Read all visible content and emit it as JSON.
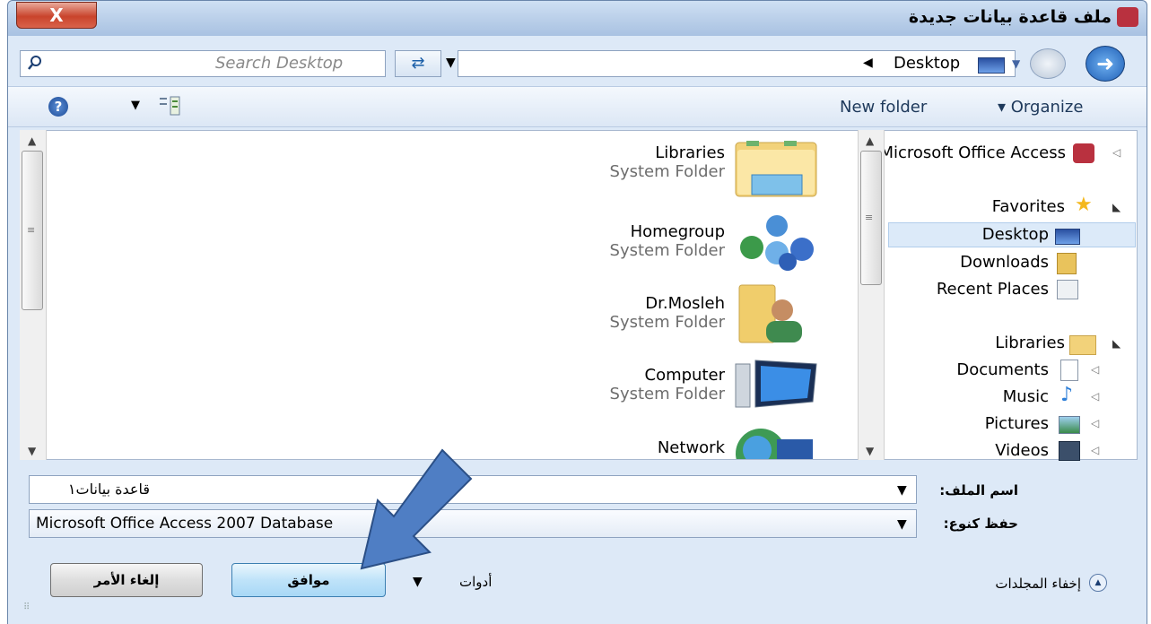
{
  "window": {
    "title": "ملف قاعدة بيانات جديدة",
    "close_label": "X"
  },
  "search": {
    "placeholder": "Search Desktop"
  },
  "address": {
    "location": "Desktop"
  },
  "toolbar": {
    "new_folder": "New folder",
    "organize": "Organize"
  },
  "files": [
    {
      "name": "Libraries",
      "type": "System Folder",
      "icon": "libraries-folder-icon"
    },
    {
      "name": "Homegroup",
      "type": "System Folder",
      "icon": "homegroup-icon"
    },
    {
      "name": "Dr.Mosleh",
      "type": "System Folder",
      "icon": "user-folder-icon"
    },
    {
      "name": "Computer",
      "type": "System Folder",
      "icon": "computer-icon"
    },
    {
      "name": "Network",
      "type": "",
      "icon": "network-icon"
    }
  ],
  "nav": {
    "top": "Microsoft Office Access",
    "favorites": "Favorites",
    "desktop": "Desktop",
    "downloads": "Downloads",
    "recent": "Recent Places",
    "libraries": "Libraries",
    "documents": "Documents",
    "music": "Music",
    "pictures": "Pictures",
    "videos": "Videos"
  },
  "form": {
    "filename_label": "اسم الملف:",
    "filename_value": "قاعدة بيانات١",
    "filetype_label": "حفظ كنوع:",
    "filetype_value": "Microsoft Office Access 2007 Database"
  },
  "footer": {
    "hide_folders": "إخفاء المجلدات",
    "tools": "أدوات",
    "ok": "موافق",
    "cancel": "إلغاء الأمر"
  },
  "accent": {
    "arrow_fill": "#4f7ec4",
    "arrow_stroke": "#2b4f86"
  }
}
